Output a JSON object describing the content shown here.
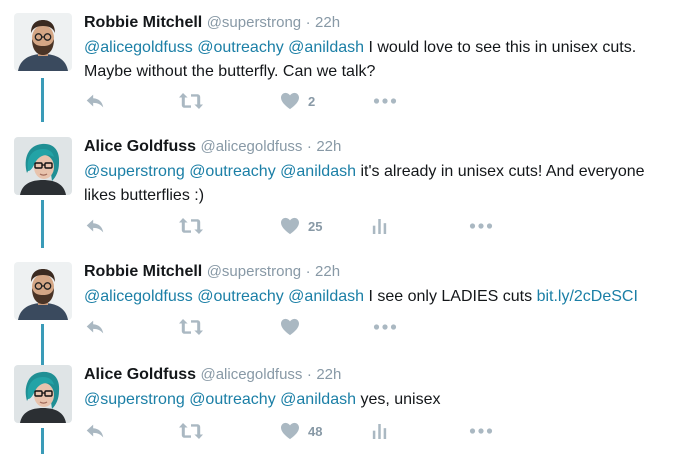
{
  "tweets": [
    {
      "name": "Robbie Mitchell",
      "handle": "@superstrong",
      "separator": "·",
      "time": "22h",
      "mentions": [
        "@alicegoldfuss",
        "@outreachy",
        "@anildash"
      ],
      "text": "I would love to see this in unisex cuts. Maybe without the butterfly. Can we talk?",
      "likes": "2",
      "avatar": "bearded-man"
    },
    {
      "name": "Alice Goldfuss",
      "handle": "@alicegoldfuss",
      "separator": "·",
      "time": "22h",
      "mentions": [
        "@superstrong",
        "@outreachy",
        "@anildash"
      ],
      "text": "it's already in unisex cuts! And everyone likes butterflies :)",
      "likes": "25",
      "avatar": "teal-hair-woman"
    },
    {
      "name": "Robbie Mitchell",
      "handle": "@superstrong",
      "separator": "·",
      "time": "22h",
      "mentions": [
        "@alicegoldfuss",
        "@outreachy",
        "@anildash"
      ],
      "text": "I see only LADIES cuts",
      "link": "bit.ly/2cDeSCI",
      "likes": "",
      "avatar": "bearded-man"
    },
    {
      "name": "Alice Goldfuss",
      "handle": "@alicegoldfuss",
      "separator": "·",
      "time": "22h",
      "mentions": [
        "@superstrong",
        "@outreachy",
        "@anildash"
      ],
      "text": "yes, unisex",
      "likes": "48",
      "avatar": "teal-hair-woman"
    }
  ],
  "icons": {
    "reply": "reply-icon",
    "retweet": "retweet-icon",
    "like": "heart-icon",
    "analytics": "analytics-icon",
    "more": "more-icon"
  },
  "colors": {
    "text": "#14171a",
    "muted": "#8899a6",
    "link": "#1b7fa6",
    "thread_line": "#3a9bb8",
    "icon": "#aab8c2"
  }
}
